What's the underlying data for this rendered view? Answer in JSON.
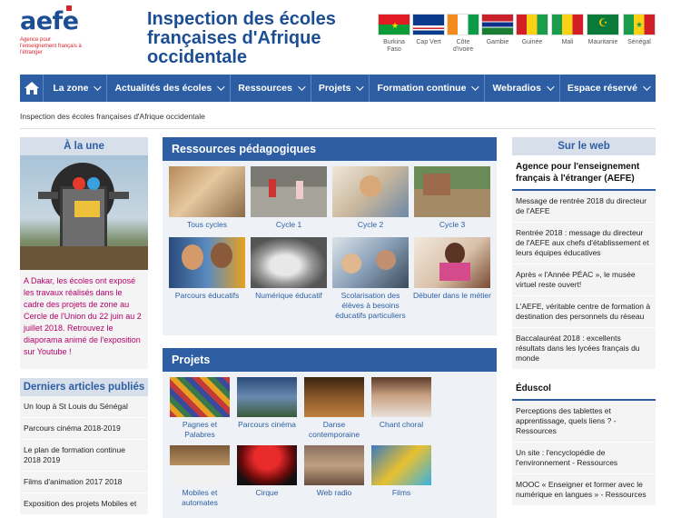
{
  "logo": {
    "word": "aefe",
    "tagline": "Agence pour l'enseignement français à l'étranger"
  },
  "site_title": "Inspection des écoles françaises d'Afrique occidentale",
  "flags": [
    {
      "name": "Burkina Faso"
    },
    {
      "name": "Cap Vert"
    },
    {
      "name": "Côte d'Ivoire"
    },
    {
      "name": "Gambie"
    },
    {
      "name": "Guinée"
    },
    {
      "name": "Mali"
    },
    {
      "name": "Mauritanie"
    },
    {
      "name": "Sénégal"
    }
  ],
  "nav": {
    "home_icon": "home-icon",
    "items": [
      "La zone",
      "Actualités des écoles",
      "Ressources",
      "Projets",
      "Formation continue",
      "Webradios",
      "Espace réservé"
    ]
  },
  "breadcrumb": "Inspection des écoles françaises d'Afrique occidentale",
  "alaune": {
    "heading": "À la une",
    "text": "A Dakar, les écoles ont exposé les travaux réalisés dans le cadre des projets de zone au Cercle de l'Union du 22 juin au 2 juillet 2018. Retrouvez le diaporama animé de l'exposition sur Youtube !"
  },
  "articles": {
    "heading": "Derniers articles publiés",
    "items": [
      "Un loup à St Louis du Sénégal",
      "Parcours cinéma 2018-2019",
      "Le plan de formation continue 2018 2019",
      "Films d'animation 2017 2018",
      "Exposition des projets Mobiles et"
    ]
  },
  "ressources": {
    "heading": "Ressources pédagogiques",
    "tiles": [
      "Tous cycles",
      "Cycle 1",
      "Cycle 2",
      "Cycle 3",
      "Parcours éducatifs",
      "Numérique éducatif",
      "Scolarisation des élèves à besoins éducatifs particuliers",
      "Débuter dans le métier"
    ]
  },
  "projets": {
    "heading": "Projets",
    "tiles": [
      "Pagnes et Palabres",
      "Parcours cinéma",
      "Danse contemporaine",
      "Chant choral",
      "Mobiles et automates",
      "Cirque",
      "Web radio",
      "Films"
    ]
  },
  "web": {
    "heading": "Sur le web",
    "aefe_title": "Agence pour l'enseignement français à l'étranger (AEFE)",
    "aefe_items": [
      "Message de rentrée 2018 du directeur de l'AEFE",
      "Rentrée 2018 : message du directeur de l'AEFE aux chefs d'établissement et leurs équipes éducatives",
      "Après « l'Année PÉAC », le musée virtuel reste ouvert!",
      "L'AEFE, véritable centre de formation à destination des personnels du réseau",
      "Baccalauréat 2018 : excellents résultats dans les lycées français du monde"
    ],
    "eduscol_title": "Éduscol",
    "eduscol_items": [
      "Perceptions des tablettes et apprentissage, quels liens ? - Ressources",
      "Un site : l'encyclopédie de l'environnement - Ressources",
      "MOOC « Enseigner et former avec le numérique en langues » - Ressources"
    ]
  },
  "colors": {
    "brand": "#2d5ea3",
    "title": "#1b4e94",
    "accent_red": "#d8232a",
    "alaune_text": "#b3006a"
  }
}
